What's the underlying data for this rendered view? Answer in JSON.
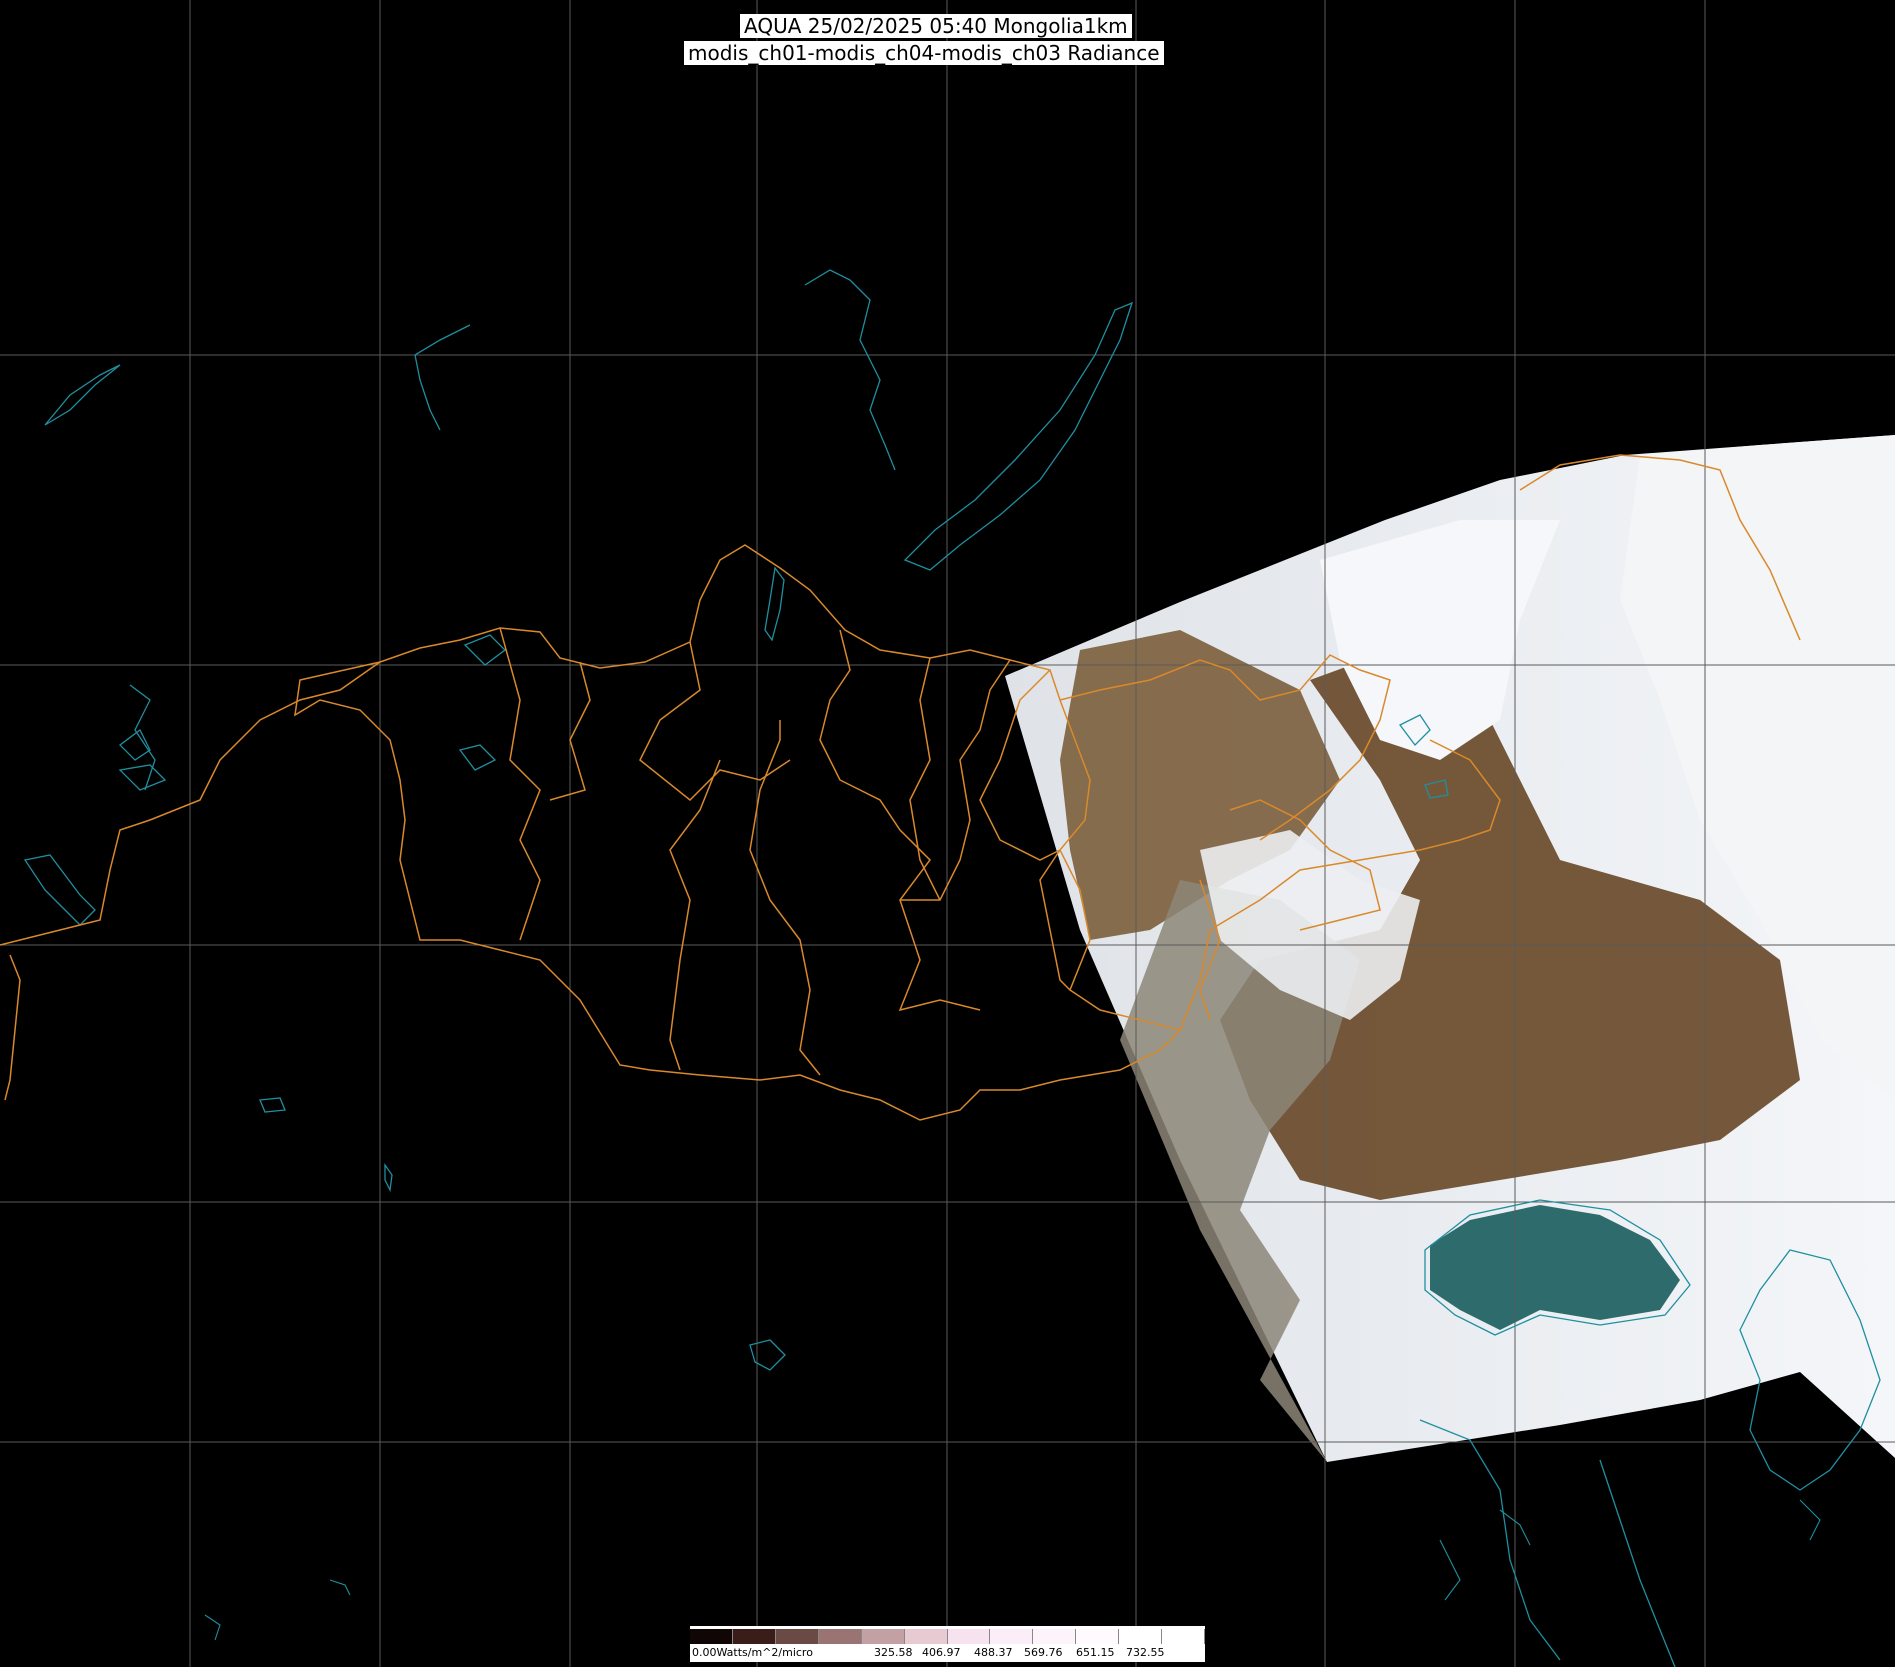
{
  "header": {
    "title_line1": "AQUA 25/02/2025 05:40 Mongolia1km",
    "title_line2": "modis_ch01-modis_ch04-modis_ch03 Radiance"
  },
  "colorbar": {
    "unit_label": "0.00Watts/m^2/micro",
    "tick_labels": [
      "325.58",
      "406.97",
      "488.37",
      "569.76",
      "651.15",
      "732.55"
    ],
    "colors": [
      "#100606",
      "#3a1c18",
      "#6b4a45",
      "#9a7473",
      "#c3a0a4",
      "#e8cad2",
      "#f7e2f0",
      "#fbeef8",
      "#fdf4fb",
      "#fefafd",
      "#ffffff",
      "#ffffff"
    ]
  },
  "map": {
    "background": "#000000",
    "grid_color": "#5a5a5a",
    "border_color": "#d9892b",
    "coast_color": "#1f8fa0",
    "snow_color": "#eef1f5",
    "land_color": "#7a5a3a",
    "sea_color": "#2f6a6a"
  }
}
